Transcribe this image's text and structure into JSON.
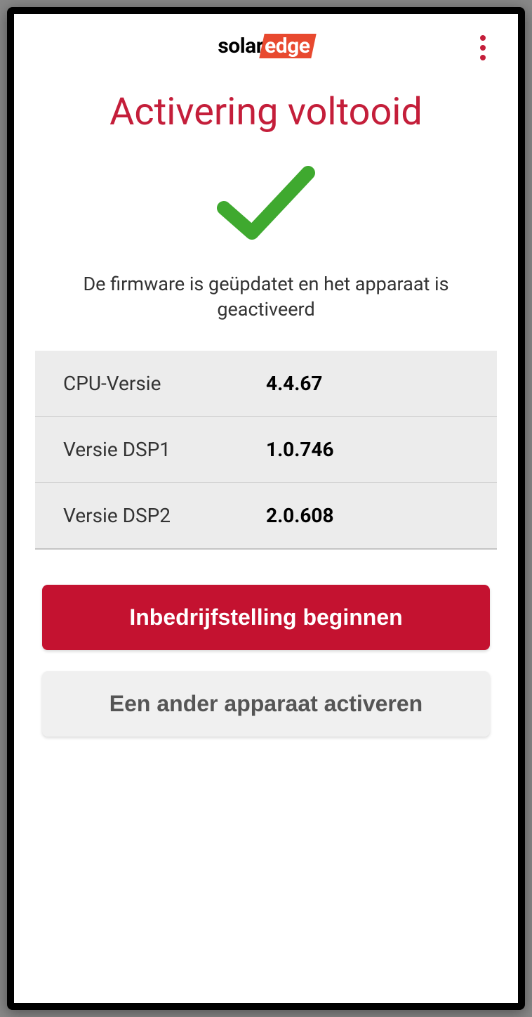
{
  "header": {
    "logo_part1": "solar",
    "logo_part2": "edge"
  },
  "page_title": "Activering voltooid",
  "status_message": "De firmware is geüpdatet en het apparaat is geactiveerd",
  "versions": [
    {
      "label": "CPU-Versie",
      "value": "4.4.67"
    },
    {
      "label": "Versie DSP1",
      "value": "1.0.746"
    },
    {
      "label": "Versie DSP2",
      "value": "2.0.608"
    }
  ],
  "buttons": {
    "primary": "Inbedrijfstelling beginnen",
    "secondary": "Een ander apparaat activeren"
  }
}
